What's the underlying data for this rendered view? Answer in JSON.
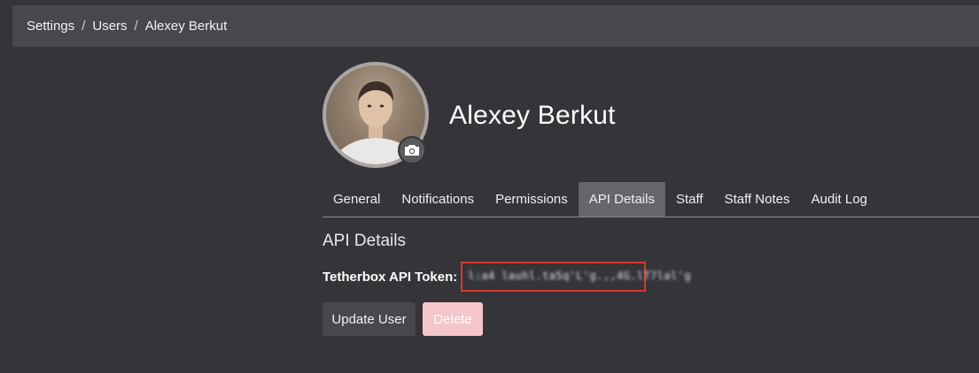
{
  "breadcrumb": {
    "items": [
      "Settings",
      "Users",
      "Alexey Berkut"
    ],
    "separator": "/"
  },
  "profile": {
    "name": "Alexey Berkut",
    "avatar_icon": "user-photo",
    "camera_icon": "camera-icon"
  },
  "tabs": {
    "items": [
      "General",
      "Notifications",
      "Permissions",
      "API Details",
      "Staff",
      "Staff Notes",
      "Audit Log"
    ],
    "active": "API Details"
  },
  "api": {
    "section_title": "API Details",
    "token_label": "Tetherbox API Token:",
    "token_value": "l:a4 lauhl.ta5q'L'g.,,4G.lT7lal'g",
    "token_highlight_color": "#d33a32"
  },
  "actions": {
    "update_label": "Update User",
    "delete_label": "Delete"
  },
  "colors": {
    "background": "#353439",
    "panel": "#48474c",
    "active_tab": "#66656a",
    "delete_button": "#f4c6cb"
  }
}
